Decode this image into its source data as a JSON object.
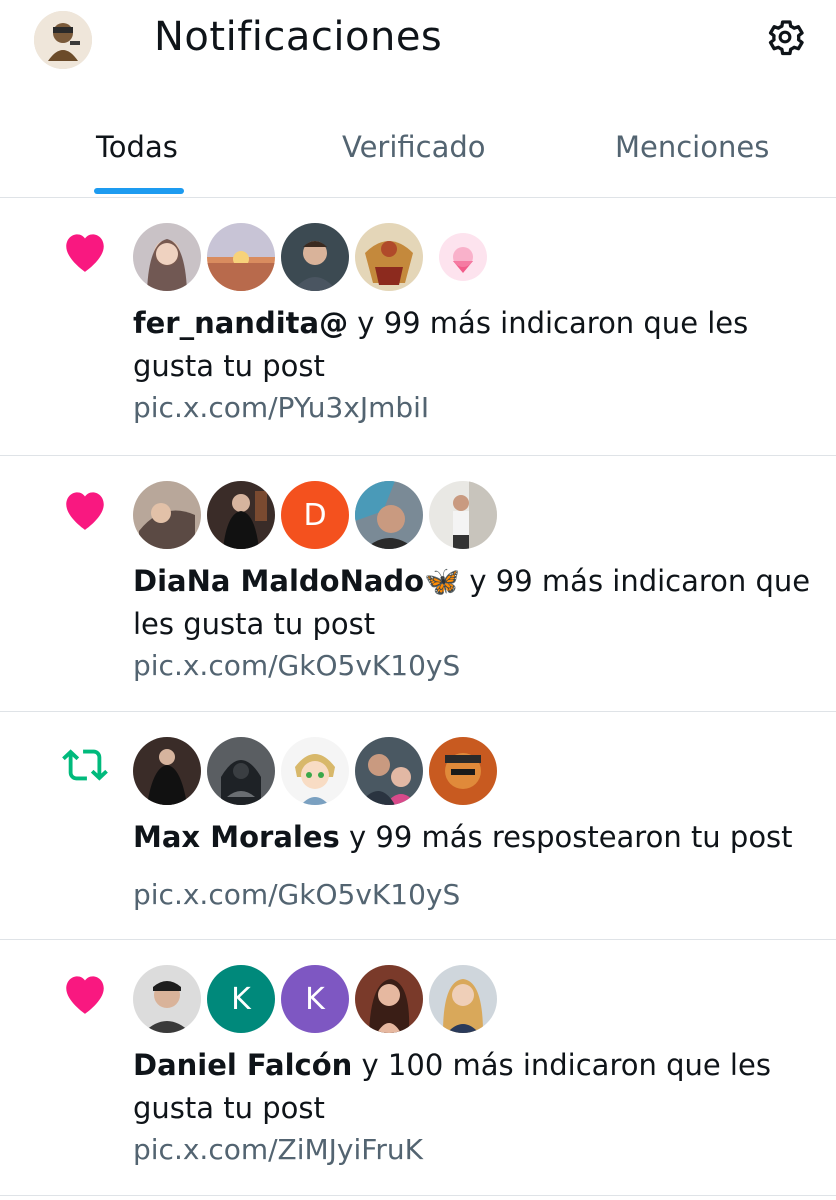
{
  "header": {
    "title": "Notificaciones",
    "avatar_icon": "profile-avatar",
    "settings_icon": "gear-icon"
  },
  "tabs": [
    {
      "label": "Todas",
      "active": true
    },
    {
      "label": "Verificado",
      "active": false
    },
    {
      "label": "Menciones",
      "active": false
    }
  ],
  "colors": {
    "like": "#f91880",
    "repost": "#00ba7c",
    "tab_underline": "#1d9bf0",
    "secondary_text": "#536471"
  },
  "notifications": [
    {
      "type": "like",
      "icon": "heart-icon",
      "name": "fer_nandita@",
      "action": " y 99 más indicaron que les gusta tu post",
      "link": "pic.x.com/PYu3xJmbiI"
    },
    {
      "type": "like",
      "icon": "heart-icon",
      "name": "DiaNa MaldoNado🦋",
      "action": " y 99 más indicaron que les gusta tu post",
      "link": "pic.x.com/GkO5vK10yS",
      "avatar_letter": "D"
    },
    {
      "type": "repost",
      "icon": "repost-icon",
      "name": "Max Morales",
      "action": " y 99 más respostearon tu post",
      "link": "pic.x.com/GkO5vK10yS"
    },
    {
      "type": "like",
      "icon": "heart-icon",
      "name": "Daniel Falcón",
      "action": " y 100 más indicaron que les gusta tu post",
      "link": "pic.x.com/ZiMJyiFruK",
      "avatar_letters": [
        "K",
        "K"
      ]
    }
  ]
}
